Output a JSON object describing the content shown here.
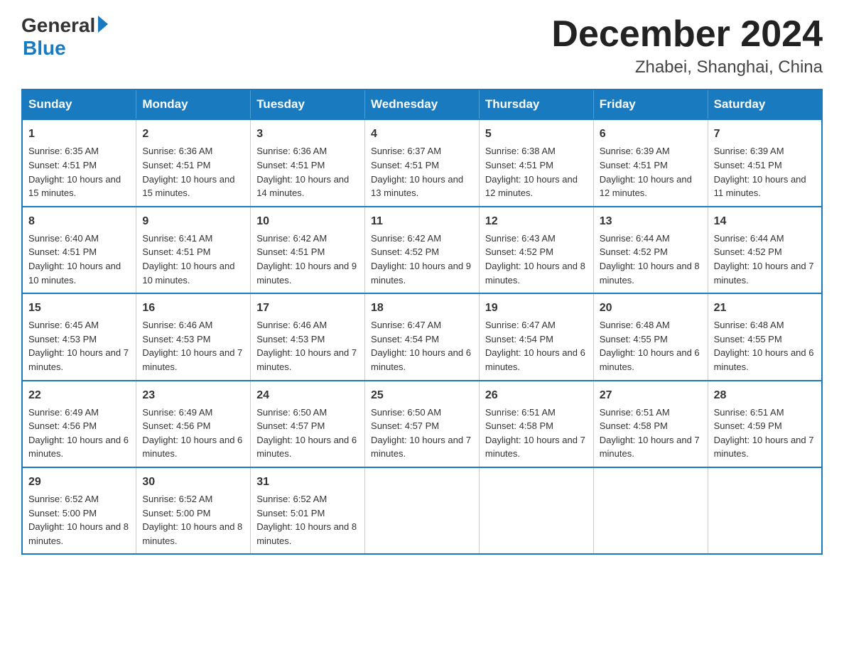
{
  "header": {
    "logo_general": "General",
    "logo_blue": "Blue",
    "month_title": "December 2024",
    "location": "Zhabei, Shanghai, China"
  },
  "weekdays": [
    "Sunday",
    "Monday",
    "Tuesday",
    "Wednesday",
    "Thursday",
    "Friday",
    "Saturday"
  ],
  "weeks": [
    [
      {
        "day": "1",
        "sunrise": "6:35 AM",
        "sunset": "4:51 PM",
        "daylight": "10 hours and 15 minutes."
      },
      {
        "day": "2",
        "sunrise": "6:36 AM",
        "sunset": "4:51 PM",
        "daylight": "10 hours and 15 minutes."
      },
      {
        "day": "3",
        "sunrise": "6:36 AM",
        "sunset": "4:51 PM",
        "daylight": "10 hours and 14 minutes."
      },
      {
        "day": "4",
        "sunrise": "6:37 AM",
        "sunset": "4:51 PM",
        "daylight": "10 hours and 13 minutes."
      },
      {
        "day": "5",
        "sunrise": "6:38 AM",
        "sunset": "4:51 PM",
        "daylight": "10 hours and 12 minutes."
      },
      {
        "day": "6",
        "sunrise": "6:39 AM",
        "sunset": "4:51 PM",
        "daylight": "10 hours and 12 minutes."
      },
      {
        "day": "7",
        "sunrise": "6:39 AM",
        "sunset": "4:51 PM",
        "daylight": "10 hours and 11 minutes."
      }
    ],
    [
      {
        "day": "8",
        "sunrise": "6:40 AM",
        "sunset": "4:51 PM",
        "daylight": "10 hours and 10 minutes."
      },
      {
        "day": "9",
        "sunrise": "6:41 AM",
        "sunset": "4:51 PM",
        "daylight": "10 hours and 10 minutes."
      },
      {
        "day": "10",
        "sunrise": "6:42 AM",
        "sunset": "4:51 PM",
        "daylight": "10 hours and 9 minutes."
      },
      {
        "day": "11",
        "sunrise": "6:42 AM",
        "sunset": "4:52 PM",
        "daylight": "10 hours and 9 minutes."
      },
      {
        "day": "12",
        "sunrise": "6:43 AM",
        "sunset": "4:52 PM",
        "daylight": "10 hours and 8 minutes."
      },
      {
        "day": "13",
        "sunrise": "6:44 AM",
        "sunset": "4:52 PM",
        "daylight": "10 hours and 8 minutes."
      },
      {
        "day": "14",
        "sunrise": "6:44 AM",
        "sunset": "4:52 PM",
        "daylight": "10 hours and 7 minutes."
      }
    ],
    [
      {
        "day": "15",
        "sunrise": "6:45 AM",
        "sunset": "4:53 PM",
        "daylight": "10 hours and 7 minutes."
      },
      {
        "day": "16",
        "sunrise": "6:46 AM",
        "sunset": "4:53 PM",
        "daylight": "10 hours and 7 minutes."
      },
      {
        "day": "17",
        "sunrise": "6:46 AM",
        "sunset": "4:53 PM",
        "daylight": "10 hours and 7 minutes."
      },
      {
        "day": "18",
        "sunrise": "6:47 AM",
        "sunset": "4:54 PM",
        "daylight": "10 hours and 6 minutes."
      },
      {
        "day": "19",
        "sunrise": "6:47 AM",
        "sunset": "4:54 PM",
        "daylight": "10 hours and 6 minutes."
      },
      {
        "day": "20",
        "sunrise": "6:48 AM",
        "sunset": "4:55 PM",
        "daylight": "10 hours and 6 minutes."
      },
      {
        "day": "21",
        "sunrise": "6:48 AM",
        "sunset": "4:55 PM",
        "daylight": "10 hours and 6 minutes."
      }
    ],
    [
      {
        "day": "22",
        "sunrise": "6:49 AM",
        "sunset": "4:56 PM",
        "daylight": "10 hours and 6 minutes."
      },
      {
        "day": "23",
        "sunrise": "6:49 AM",
        "sunset": "4:56 PM",
        "daylight": "10 hours and 6 minutes."
      },
      {
        "day": "24",
        "sunrise": "6:50 AM",
        "sunset": "4:57 PM",
        "daylight": "10 hours and 6 minutes."
      },
      {
        "day": "25",
        "sunrise": "6:50 AM",
        "sunset": "4:57 PM",
        "daylight": "10 hours and 7 minutes."
      },
      {
        "day": "26",
        "sunrise": "6:51 AM",
        "sunset": "4:58 PM",
        "daylight": "10 hours and 7 minutes."
      },
      {
        "day": "27",
        "sunrise": "6:51 AM",
        "sunset": "4:58 PM",
        "daylight": "10 hours and 7 minutes."
      },
      {
        "day": "28",
        "sunrise": "6:51 AM",
        "sunset": "4:59 PM",
        "daylight": "10 hours and 7 minutes."
      }
    ],
    [
      {
        "day": "29",
        "sunrise": "6:52 AM",
        "sunset": "5:00 PM",
        "daylight": "10 hours and 8 minutes."
      },
      {
        "day": "30",
        "sunrise": "6:52 AM",
        "sunset": "5:00 PM",
        "daylight": "10 hours and 8 minutes."
      },
      {
        "day": "31",
        "sunrise": "6:52 AM",
        "sunset": "5:01 PM",
        "daylight": "10 hours and 8 minutes."
      },
      null,
      null,
      null,
      null
    ]
  ]
}
